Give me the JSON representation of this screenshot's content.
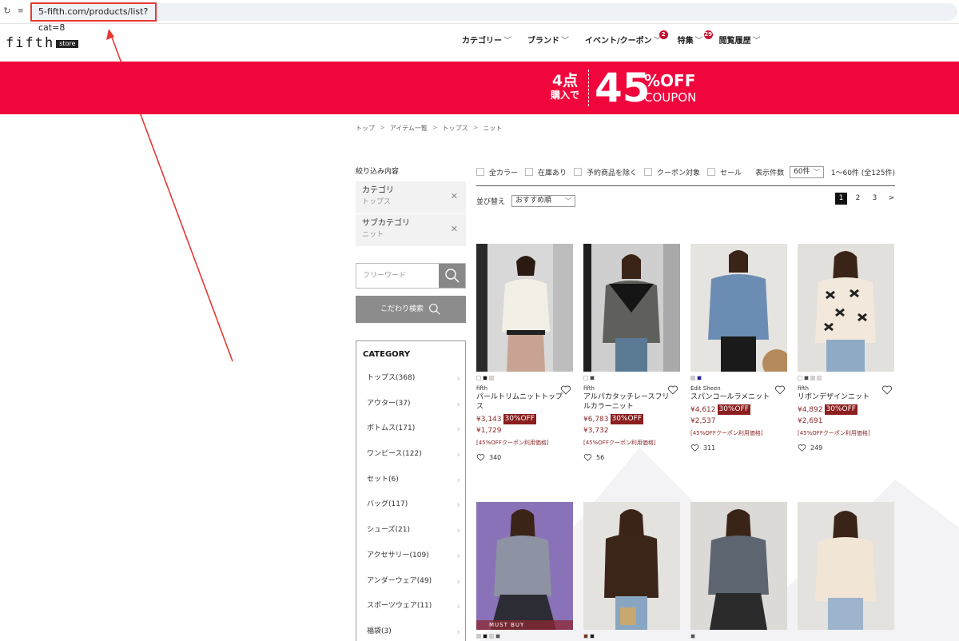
{
  "browser": {
    "url": "5-fifth.com/products/list?cat=8"
  },
  "header": {
    "logo": "fifth",
    "logo_sub": "store",
    "nav": [
      {
        "label": "カテゴリー",
        "badge": ""
      },
      {
        "label": "ブランド",
        "badge": ""
      },
      {
        "label": "イベント/クーポン",
        "badge": "2"
      },
      {
        "label": "特集",
        "badge": "29"
      },
      {
        "label": "閲覧履歴",
        "badge": ""
      }
    ]
  },
  "banner": {
    "line1": "4点",
    "line2": "購入で",
    "number": "45",
    "pct": "%OFF",
    "coupon": "COUPON"
  },
  "breadcrumb": [
    "トップ",
    "アイテム一覧",
    "トップス",
    "ニット"
  ],
  "sidebar": {
    "title": "絞り込み内容",
    "filters": [
      {
        "name": "カテゴリ",
        "value": "トップス"
      },
      {
        "name": "サブカテゴリ",
        "value": "ニット"
      }
    ],
    "search_placeholder": "フリーワード",
    "advanced_label": "こだわり検索",
    "category_title": "CATEGORY",
    "categories": [
      "トップス(368)",
      "アウター(37)",
      "ボトムス(171)",
      "ワンピース(122)",
      "セット(6)",
      "バッグ(117)",
      "シューズ(21)",
      "アクセサリー(109)",
      "アンダーウェア(49)",
      "スポーツウェア(11)",
      "福袋(3)"
    ]
  },
  "toolbar": {
    "checks": [
      "全カラー",
      "在庫あり",
      "予約商品を除く",
      "クーポン対象",
      "セール"
    ],
    "perpage_label": "表示件数",
    "perpage_value": "60件",
    "range": "1〜60件 (全125件)",
    "sort_label": "並び替え",
    "sort_value": "おすすめ順",
    "pages": [
      "1",
      "2",
      "3",
      ">"
    ]
  },
  "products": [
    {
      "brand": "fifth",
      "name": "パールトリムニットトップス",
      "old_price": "¥3,143",
      "off": "30%OFF",
      "price": "¥1,729",
      "note": "[45%OFFクーポン利用価格]",
      "likes": "340",
      "swatches": [
        "#ffffff",
        "#111111",
        "#e8d3c4"
      ]
    },
    {
      "brand": "fifth",
      "name": "アルパカタッチレースフリルカラーニット",
      "old_price": "¥6,783",
      "off": "30%OFF",
      "price": "¥3,732",
      "note": "[45%OFFクーポン利用価格]",
      "likes": "56",
      "swatches": [
        "#ffffff",
        "#444444"
      ]
    },
    {
      "brand": "Edit Sheen",
      "name": "スパンコールラメニット",
      "old_price": "¥4,612",
      "off": "30%OFF",
      "price": "¥2,537",
      "note": "[45%OFFクーポン利用価格]",
      "likes": "311",
      "swatches": [
        "#c9c7d6",
        "#1a1aa8"
      ]
    },
    {
      "brand": "fifth",
      "name": "リボンデザインニット",
      "old_price": "¥4,892",
      "off": "30%OFF",
      "price": "¥2,691",
      "note": "[45%OFFクーポン利用価格]",
      "likes": "249",
      "swatches": [
        "#ffffff",
        "#444444",
        "#cfcfcf",
        "#f3d3de"
      ]
    }
  ],
  "products_row2": [
    {
      "tag": "MUST BUY",
      "swatches": [
        "#cccccc",
        "#111111",
        "#cfcfcf",
        "#555555"
      ]
    },
    {
      "tag": "",
      "swatches": [
        "#6b3a25",
        "#1d1d1d"
      ]
    },
    {
      "tag": "",
      "swatches": [
        "#555555"
      ]
    },
    {
      "tag": "",
      "swatches": []
    }
  ]
}
